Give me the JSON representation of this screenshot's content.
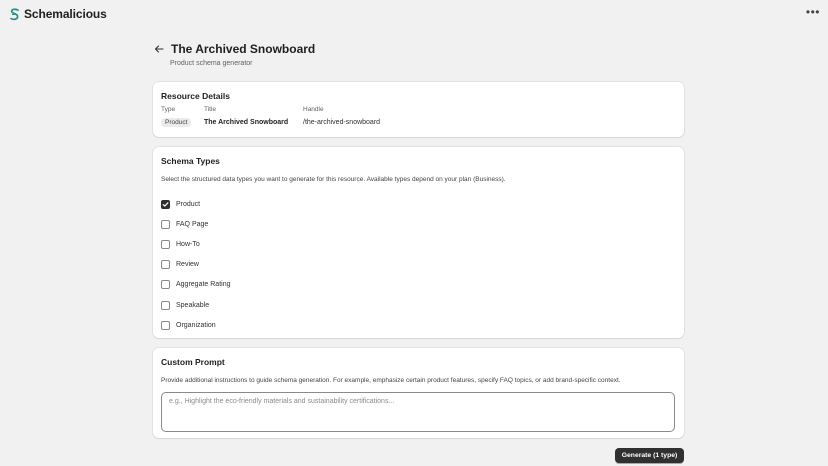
{
  "app": {
    "name": "Schemalicious",
    "logo_icon": "schemalicious-s-logo",
    "menu_icon": "more-horizontal-icon",
    "menu_glyph": "•••"
  },
  "page": {
    "title": "The Archived Snowboard",
    "subtitle": "Product schema generator",
    "back_icon": "arrow-left-icon"
  },
  "resource_details": {
    "heading": "Resource Details",
    "type_label": "Type",
    "type_value": "Product",
    "title_label": "Title",
    "title_value": "The Archived Snowboard",
    "handle_label": "Handle",
    "handle_value": "/the-archived-snowboard"
  },
  "schema_types": {
    "heading": "Schema Types",
    "description": "Select the structured data types you want to generate for this resource. Available types depend on your plan (Business).",
    "options": [
      {
        "label": "Product",
        "checked": true
      },
      {
        "label": "FAQ Page",
        "checked": false
      },
      {
        "label": "How-To",
        "checked": false
      },
      {
        "label": "Review",
        "checked": false
      },
      {
        "label": "Aggregate Rating",
        "checked": false
      },
      {
        "label": "Speakable",
        "checked": false
      },
      {
        "label": "Organization",
        "checked": false
      }
    ]
  },
  "custom_prompt": {
    "heading": "Custom Prompt",
    "description": "Provide additional instructions to guide schema generation. For example, emphasize certain product features, specify FAQ topics, or add brand-specific context.",
    "placeholder": "e.g., Highlight the eco-friendly materials and sustainability certifications...",
    "value": ""
  },
  "actions": {
    "generate_label": "Generate (1 type)"
  },
  "colors": {
    "background": "#f1f1f1",
    "card": "#ffffff",
    "primary_button": "#303030",
    "brand": "#2a8f8a"
  }
}
